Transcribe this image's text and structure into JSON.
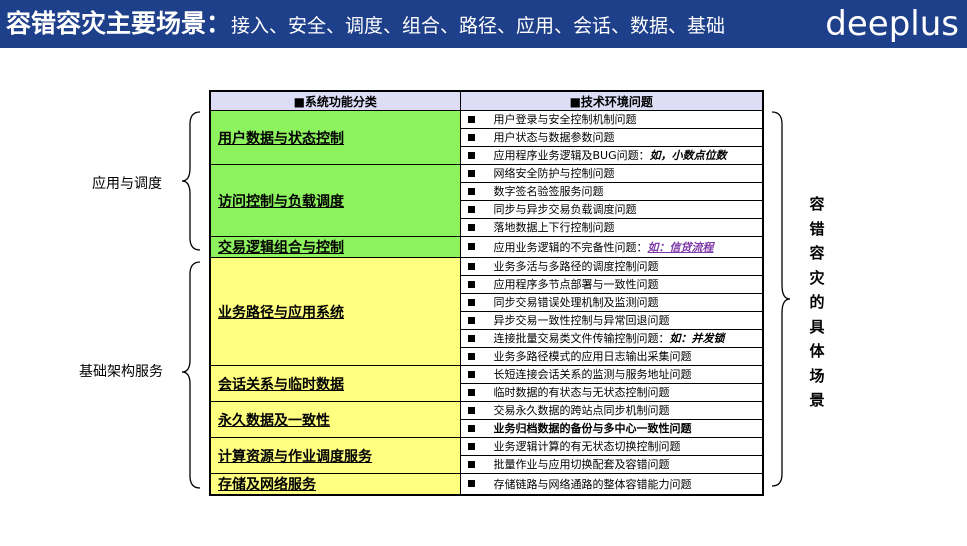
{
  "header": {
    "title_main": "容错容灾主要场景：",
    "title_sub": "接入、安全、调度、组合、路径、应用、会话、数据、基础",
    "logo": "deeplus"
  },
  "table": {
    "col1_header": "■系统功能分类",
    "col2_header": "■技术环境问题",
    "categories": [
      {
        "name": "用户数据与状态控制",
        "color": "green",
        "items": [
          {
            "text": "用户登录与安全控制机制问题"
          },
          {
            "text": "用户状态与数据参数问题"
          },
          {
            "text": "应用程序业务逻辑及BUG问题：",
            "emph": "如，小数点位数"
          }
        ]
      },
      {
        "name": "访问控制与负载调度",
        "color": "green",
        "items": [
          {
            "text": "网络安全防护与控制问题"
          },
          {
            "text": "数字签名验签服务问题"
          },
          {
            "text": "同步与异步交易负载调度问题"
          },
          {
            "text": "落地数据上下行控制问题"
          }
        ]
      },
      {
        "name": "交易逻辑组合与控制",
        "color": "green",
        "items": [
          {
            "text": "应用业务逻辑的不完备性问题：",
            "emph_purple": "如：信贷流程"
          }
        ]
      },
      {
        "name": "业务路径与应用系统",
        "color": "yellow",
        "items": [
          {
            "text": "业务多活与多路径的调度控制问题"
          },
          {
            "text": "应用程序多节点部署与一致性问题"
          },
          {
            "text": "同步交易错误处理机制及监测问题"
          },
          {
            "text": "异步交易一致性控制与异常回退问题"
          },
          {
            "text": "连接批量交易类文件传输控制问题：",
            "emph": "如：并发锁"
          },
          {
            "text": "业务多路径模式的应用日志输出采集问题"
          }
        ]
      },
      {
        "name": "会话关系与临时数据",
        "color": "yellow",
        "items": [
          {
            "text": "长短连接会话关系的监测与服务地址问题"
          },
          {
            "text": "临时数据的有状态与无状态控制问题"
          }
        ]
      },
      {
        "name": "永久数据及一致性",
        "color": "yellow",
        "items": [
          {
            "text": "交易永久数据的跨站点同步机制问题"
          },
          {
            "text": "业务归档数据的备份与多中心一致性问题",
            "bold": true
          }
        ]
      },
      {
        "name": "计算资源与作业调度服务",
        "color": "yellow",
        "items": [
          {
            "text": "业务逻辑计算的有无状态切换控制问题"
          },
          {
            "text": "批量作业与应用切换配套及容错问题"
          }
        ]
      },
      {
        "name": "存储及网络服务",
        "color": "yellow",
        "items": [
          {
            "text": "存储链路与网络通路的整体容错能力问题"
          }
        ]
      }
    ]
  },
  "labels": {
    "app_group": "应用与调度",
    "infra_group": "基础架构服务",
    "vertical": "容错容灾的具体场景"
  },
  "colors": {
    "header_bg": "#1e3f8a",
    "green": "#8cf25e",
    "yellow": "#ffff80",
    "col_header_bg": "#ddddf6"
  }
}
